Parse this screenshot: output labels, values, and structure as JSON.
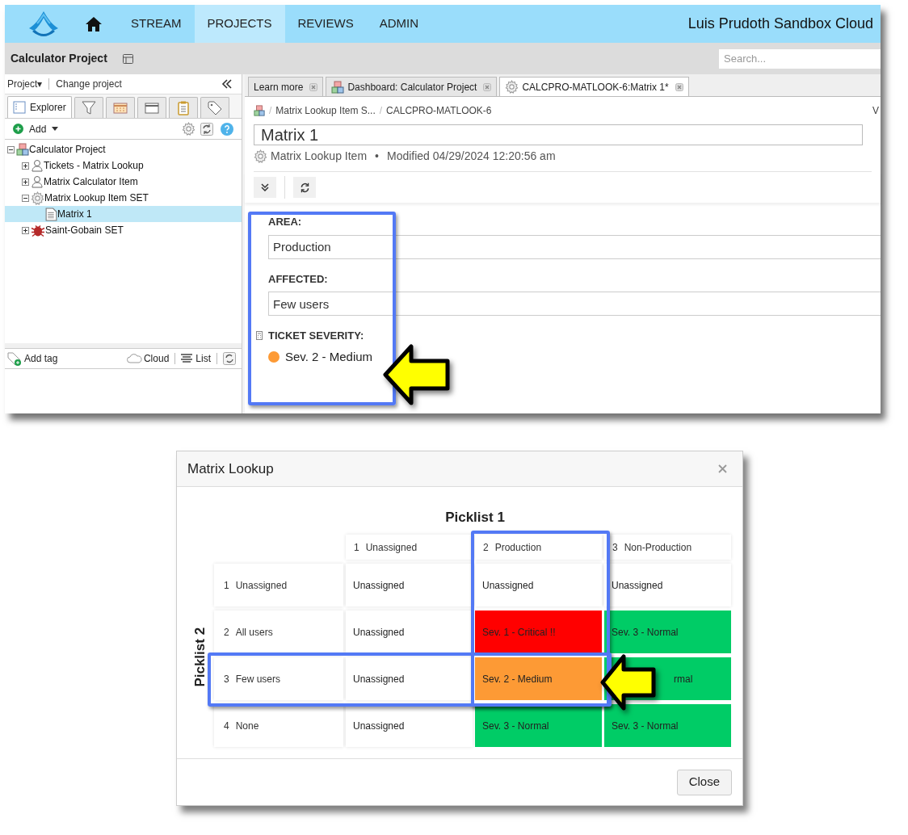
{
  "nav": {
    "items": [
      {
        "label": "STREAM",
        "selected": false
      },
      {
        "label": "PROJECTS",
        "selected": true
      },
      {
        "label": "REVIEWS",
        "selected": false
      },
      {
        "label": "ADMIN",
        "selected": false
      }
    ],
    "account": "Luis Prudoth Sandbox Cloud"
  },
  "project_bar": {
    "title": "Calculator Project",
    "search": {
      "placeholder": "Search..."
    }
  },
  "sidebar": {
    "project_menu": "Project▾",
    "change_project": "Change project",
    "tabs": [
      {
        "kind": "explorer",
        "label": "Explorer",
        "selected": true
      },
      {
        "kind": "filter",
        "selected": false
      },
      {
        "kind": "calendar",
        "selected": false
      },
      {
        "kind": "window",
        "selected": false
      },
      {
        "kind": "clipboard",
        "selected": false
      },
      {
        "kind": "tag",
        "selected": false
      }
    ],
    "add": "Add",
    "tree": [
      {
        "label": "Calculator Project",
        "kind": "project",
        "expanded": true,
        "selected": false,
        "children": [
          {
            "label": "Tickets - Matrix Lookup",
            "kind": "users",
            "expanded": false,
            "selected": false
          },
          {
            "label": "Matrix Calculator Item",
            "kind": "users",
            "expanded": false,
            "selected": false
          },
          {
            "label": "Matrix Lookup Item SET",
            "kind": "gear",
            "expanded": true,
            "selected": false,
            "children": [
              {
                "label": "Matrix 1",
                "kind": "document",
                "selected": true
              }
            ]
          },
          {
            "label": "Saint-Gobain SET",
            "kind": "bug",
            "expanded": false,
            "selected": false
          }
        ]
      }
    ],
    "tag_bar": {
      "add_tag": "Add tag",
      "cloud": "Cloud",
      "list": "List"
    }
  },
  "content": {
    "tabs": [
      {
        "label": "Learn more",
        "kind": "plain",
        "selected": false
      },
      {
        "label": "Dashboard: Calculator Project",
        "kind": "project",
        "selected": false
      },
      {
        "label": "CALCPRO-MATLOOK-6:Matrix 1*",
        "kind": "gear",
        "selected": true
      }
    ],
    "breadcrumb": [
      "Matrix Lookup Item S...",
      "CALCPRO-MATLOOK-6"
    ],
    "breadcrumb_separator": "/",
    "edge_text": "V",
    "meta_separator": "•",
    "title": "Matrix 1",
    "item_type": "Matrix Lookup Item",
    "modified": "Modified 04/29/2024 12:20:56 am",
    "fields": [
      {
        "kind": "text",
        "label": "AREA:",
        "value": "Production"
      },
      {
        "kind": "text",
        "label": "AFFECTED:",
        "value": "Few users"
      },
      {
        "kind": "calculated",
        "label": "TICKET SEVERITY:",
        "value": "Sev. 2 - Medium",
        "color": "#fd9a35"
      }
    ]
  },
  "dialog": {
    "title": "Matrix Lookup",
    "column_axis": "Picklist 1",
    "row_axis": "Picklist 2",
    "columns": [
      {
        "number": "1",
        "label": "Unassigned"
      },
      {
        "number": "2",
        "label": "Production"
      },
      {
        "number": "3",
        "label": "Non-Production"
      }
    ],
    "rows": [
      {
        "number": "1",
        "label": "Unassigned",
        "cells": [
          {
            "text": "Unassigned"
          },
          {
            "text": "Unassigned"
          },
          {
            "text": "Unassigned"
          }
        ]
      },
      {
        "number": "2",
        "label": "All users",
        "cells": [
          {
            "text": "Unassigned"
          },
          {
            "text": "Sev. 1 - Critical !!",
            "color": "#ff0000"
          },
          {
            "text": "Sev. 3 - Normal",
            "color": "#00cc66"
          }
        ]
      },
      {
        "number": "3",
        "label": "Few users",
        "cells": [
          {
            "text": "Unassigned"
          },
          {
            "text": "Sev. 2 - Medium",
            "color": "#fd9a35"
          },
          {
            "text": "rmal",
            "color": "#00cc66",
            "covered": true
          }
        ]
      },
      {
        "number": "4",
        "label": "None",
        "cells": [
          {
            "text": "Unassigned"
          },
          {
            "text": "Sev. 3 - Normal",
            "color": "#00cc66"
          },
          {
            "text": "Sev. 3 - Normal",
            "color": "#00cc66"
          }
        ]
      }
    ],
    "close": "Close"
  }
}
